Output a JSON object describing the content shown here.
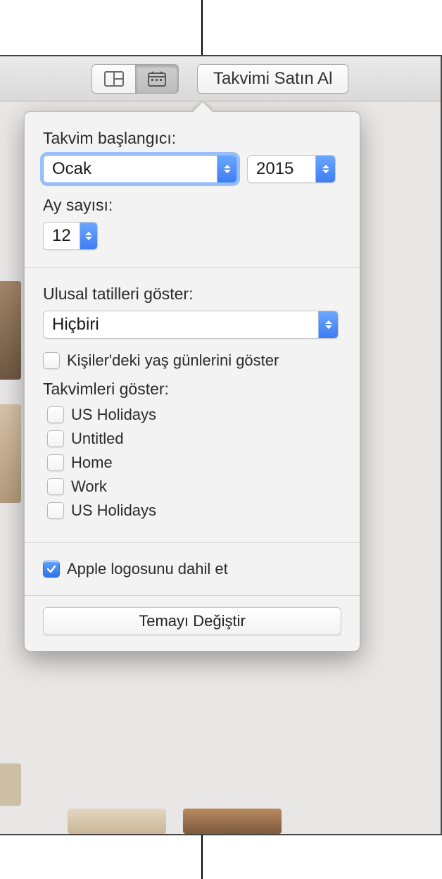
{
  "toolbar": {
    "layout_view_icon": "layout-grid-icon",
    "calendar_settings_icon": "calendar-icon",
    "buy_label": "Takvimi Satın Al"
  },
  "popover": {
    "start_label": "Takvim başlangıcı:",
    "month_value": "Ocak",
    "year_value": "2015",
    "months_count_label": "Ay sayısı:",
    "months_count_value": "12",
    "holidays_label": "Ulusal tatilleri göster:",
    "holidays_value": "Hiçbiri",
    "birthdays_label": "Kişiler'deki yaş günlerini göster",
    "birthdays_checked": false,
    "show_calendars_label": "Takvimleri göster:",
    "calendars": [
      {
        "label": "US Holidays",
        "checked": false
      },
      {
        "label": "Untitled",
        "checked": false
      },
      {
        "label": "Home",
        "checked": false
      },
      {
        "label": "Work",
        "checked": false
      },
      {
        "label": "US Holidays",
        "checked": false
      }
    ],
    "include_logo_label": "Apple logosunu dahil et",
    "include_logo_checked": true,
    "change_theme_label": "Temayı Değiştir"
  }
}
